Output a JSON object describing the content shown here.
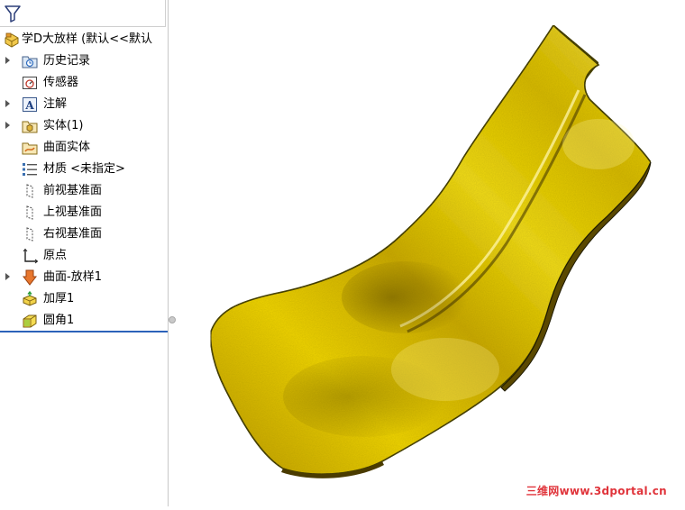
{
  "tree": {
    "root_label": "学D大放样 (默认<<默认",
    "items": [
      {
        "label": "历史记录",
        "icon": "history-folder-icon",
        "expandable": true
      },
      {
        "label": "传感器",
        "icon": "sensor-icon",
        "expandable": false
      },
      {
        "label": "注解",
        "icon": "annotation-icon",
        "expandable": true
      },
      {
        "label": "实体(1)",
        "icon": "solid-bodies-icon",
        "expandable": true
      },
      {
        "label": "曲面实体",
        "icon": "surface-bodies-icon",
        "expandable": false
      },
      {
        "label": "材质 <未指定>",
        "icon": "material-icon",
        "expandable": false
      },
      {
        "label": "前视基准面",
        "icon": "plane-icon",
        "expandable": false
      },
      {
        "label": "上视基准面",
        "icon": "plane-icon",
        "expandable": false
      },
      {
        "label": "右视基准面",
        "icon": "plane-icon",
        "expandable": false
      },
      {
        "label": "原点",
        "icon": "origin-icon",
        "expandable": false
      },
      {
        "label": "曲面-放样1",
        "icon": "surface-loft-icon",
        "expandable": true
      },
      {
        "label": "加厚1",
        "icon": "thicken-icon",
        "expandable": false
      },
      {
        "label": "圆角1",
        "icon": "fillet-icon",
        "expandable": false
      }
    ]
  },
  "watermark": "三维网www.3dportal.cn",
  "colors": {
    "model_gold": "#e1c400",
    "model_shadow": "#5c4900",
    "rollback_bar": "#2b62b9",
    "watermark": "#e0343b"
  }
}
